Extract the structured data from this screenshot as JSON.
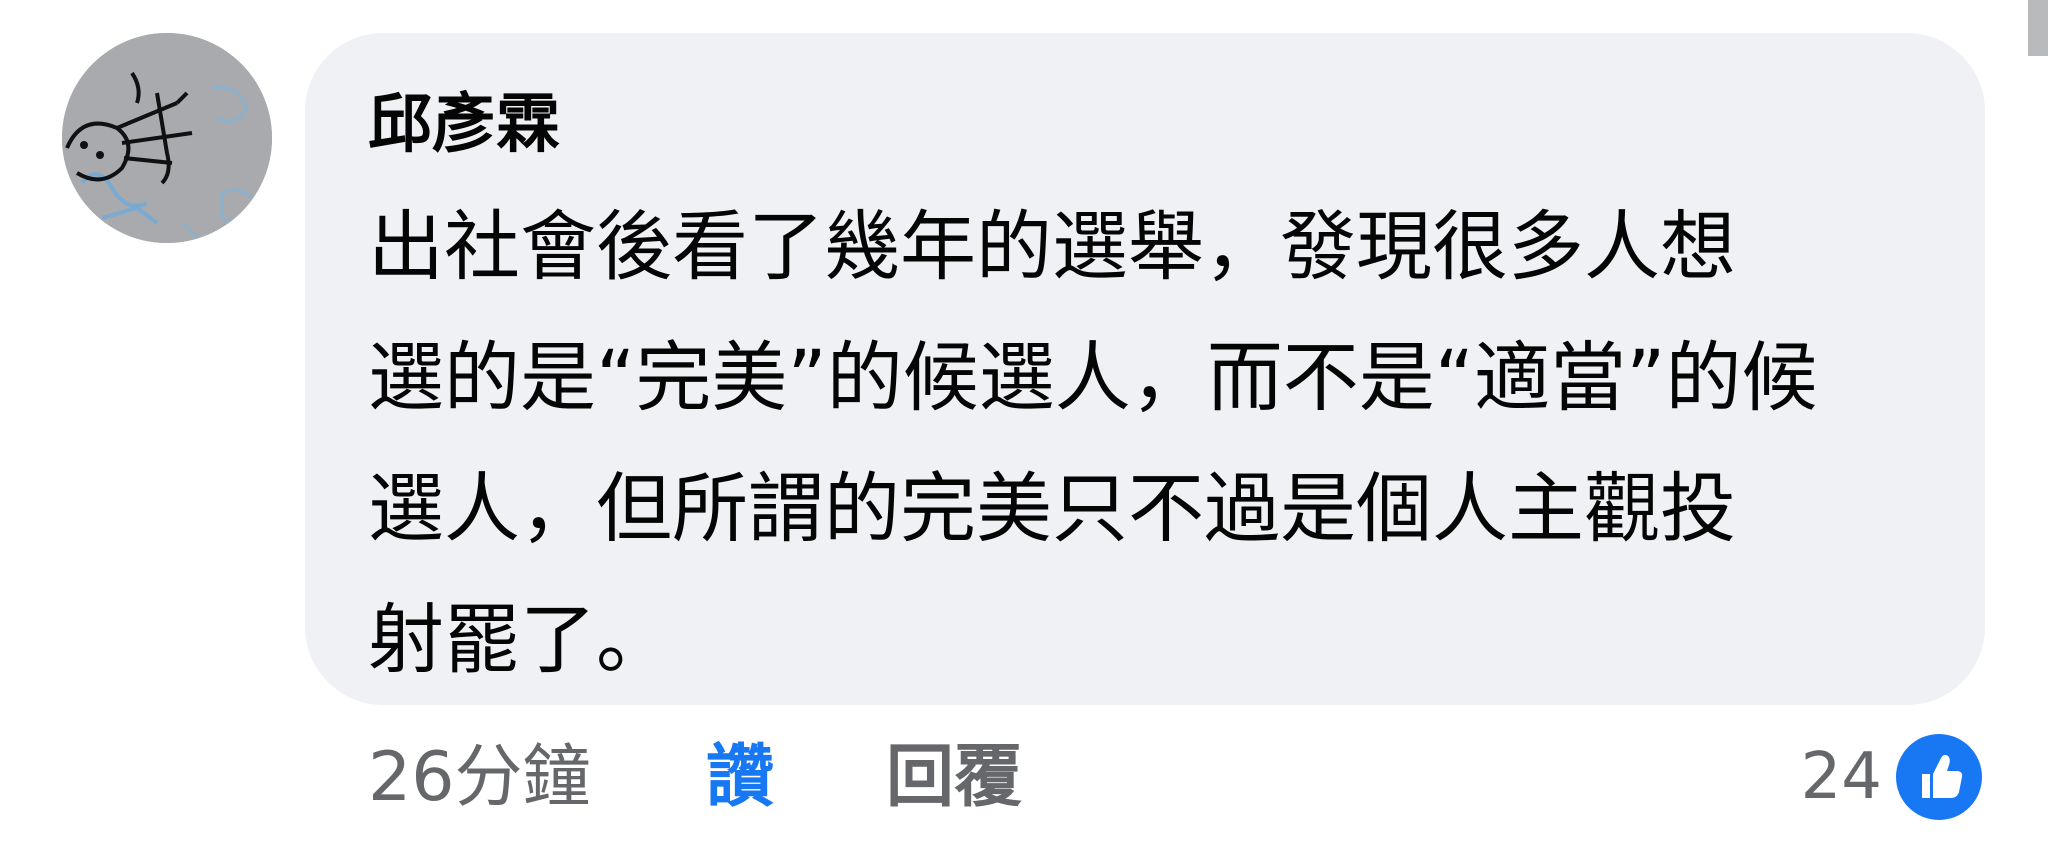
{
  "comment": {
    "author": "邱彥霖",
    "text_lines": [
      "出社會後看了幾年的選舉，發現很多人想",
      "選的是“完美”的候選人，而不是“適當”的候",
      "選人，但所謂的完美只不過是個人主觀投",
      "射罷了。"
    ],
    "avatar_icon": "doodle-avatar"
  },
  "footer": {
    "timestamp": "26分鐘",
    "like_label": "讚",
    "reply_label": "回覆"
  },
  "reactions": {
    "count": "24",
    "icon": "like-thumb-icon",
    "icon_color": "#1877f2"
  },
  "colors": {
    "bubble_bg": "#f0f1f4",
    "text": "#050505",
    "secondary_text": "#65676b",
    "accent": "#1877f2"
  }
}
